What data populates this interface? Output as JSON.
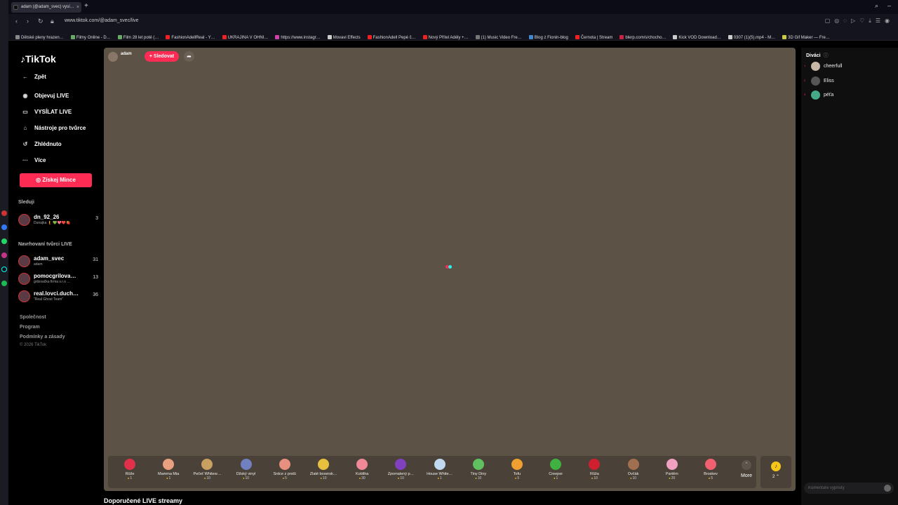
{
  "browser": {
    "tab_title": "adam (@adam_svec) vysí…",
    "tab_close": "×",
    "new_tab": "+",
    "url": "www.tiktok.com/@adam_svec/live",
    "bookmarks": [
      {
        "label": "Dětské pleny hrazen…",
        "color": "#888"
      },
      {
        "label": "Filmy Online - D…",
        "color": "#6a6"
      },
      {
        "label": "Film 28 let poté (…",
        "color": "#6a6"
      },
      {
        "label": "FashionAdellReal - Y…",
        "color": "#e22"
      },
      {
        "label": "UKRAJINA V OHNI…",
        "color": "#e22"
      },
      {
        "label": "https://www.instagr…",
        "color": "#c4a"
      },
      {
        "label": "Movavi Effects",
        "color": "#ccc"
      },
      {
        "label": "FashionAdell Pepé č…",
        "color": "#e22"
      },
      {
        "label": "Nový Přítel Adély +…",
        "color": "#e22"
      },
      {
        "label": "(1) Music Video Fre…",
        "color": "#777"
      },
      {
        "label": "Blog z Fionin-blog",
        "color": "#48c"
      },
      {
        "label": "Černota | Stream",
        "color": "#e22"
      },
      {
        "label": "blerp.com/s/chocho…",
        "color": "#c24"
      },
      {
        "label": "Kick VOD Download…",
        "color": "#ccc"
      },
      {
        "label": "0307 (1)(5).mp4 - M…",
        "color": "#ccc"
      },
      {
        "label": "3D Gif Maker — Fre…",
        "color": "#cc4"
      }
    ]
  },
  "sidebar": {
    "logo": "TikTok",
    "back": "Zpět",
    "nav": [
      {
        "label": "Objevuj LIVE",
        "icon": "live-icon"
      },
      {
        "label": "VYSÍLAT LIVE",
        "icon": "camera-icon"
      },
      {
        "label": "Nástroje pro tvůrce",
        "icon": "home-icon"
      },
      {
        "label": "Zhlédnuto",
        "icon": "history-icon"
      },
      {
        "label": "Více",
        "icon": "more-icon"
      }
    ],
    "coins_button": "Získej Mince",
    "following_title": "Sleduji",
    "following": [
      {
        "name": "dn_92_26",
        "sub": "Dunajka 🧜 💚💖❤️🍓",
        "count": "3"
      }
    ],
    "suggested_title": "Navrhovaní tvůrci LIVE",
    "suggested": [
      {
        "name": "adam_svec",
        "sub": "adam",
        "count": "31"
      },
      {
        "name": "pomocgrilova…",
        "sub": "grilovačka firma s.r.o …",
        "count": "13"
      },
      {
        "name": "real.lovci.duch…",
        "sub": "\"Real Ghost Team\"",
        "count": "36"
      }
    ],
    "footer_links": [
      "Společnost",
      "Program",
      "Podmínky a zásady"
    ],
    "copyright": "© 2026 TikTok"
  },
  "stream": {
    "host_name": "adam",
    "follow_label": "+ Sledovat",
    "gifts": [
      {
        "name": "Růže",
        "price": "1",
        "color": "#e0304a"
      },
      {
        "name": "Mamma Mia",
        "price": "1",
        "color": "#e8a080"
      },
      {
        "name": "Pečeť Whitew…",
        "price": "10",
        "color": "#c8a060"
      },
      {
        "name": "Džský vinyl",
        "price": "10",
        "color": "#7080c0"
      },
      {
        "name": "Srdce z prstů",
        "price": "5",
        "color": "#e89080"
      },
      {
        "name": "Zlaté boxersk…",
        "price": "10",
        "color": "#e8c040"
      },
      {
        "name": "Kobliha",
        "price": "30",
        "color": "#f08898"
      },
      {
        "name": "Zpomalený p…",
        "price": "10",
        "color": "#8040c0"
      },
      {
        "name": "House White…",
        "price": "1",
        "color": "#c0d8f0"
      },
      {
        "name": "Tiny Diny",
        "price": "10",
        "color": "#60c060"
      },
      {
        "name": "Tofu",
        "price": "5",
        "color": "#f0a030"
      },
      {
        "name": "Creeper",
        "price": "1",
        "color": "#40b040"
      },
      {
        "name": "Růža",
        "price": "10",
        "color": "#d02030"
      },
      {
        "name": "Ovčák",
        "price": "10",
        "color": "#a07050"
      },
      {
        "name": "Partěm",
        "price": "20",
        "color": "#f0a0c0"
      },
      {
        "name": "Broskev",
        "price": "5",
        "color": "#f06070"
      }
    ],
    "more_label": "More",
    "more_arrow": "⌃",
    "coin_balance": "2 ⌃",
    "coin_symbol": "♪"
  },
  "recommended_title": "Doporučené LIVE streamy",
  "viewers": {
    "title": "Diváci",
    "help": "ⓘ",
    "list": [
      {
        "rank": "1",
        "name": "cheerfull",
        "color": "#c8b8a8"
      },
      {
        "rank": "2",
        "name": "Eliss",
        "color": "#555"
      },
      {
        "rank": "3",
        "name": "péťa",
        "color": "#4a8"
      }
    ]
  },
  "comment_placeholder": "Komentáře vypnuty"
}
